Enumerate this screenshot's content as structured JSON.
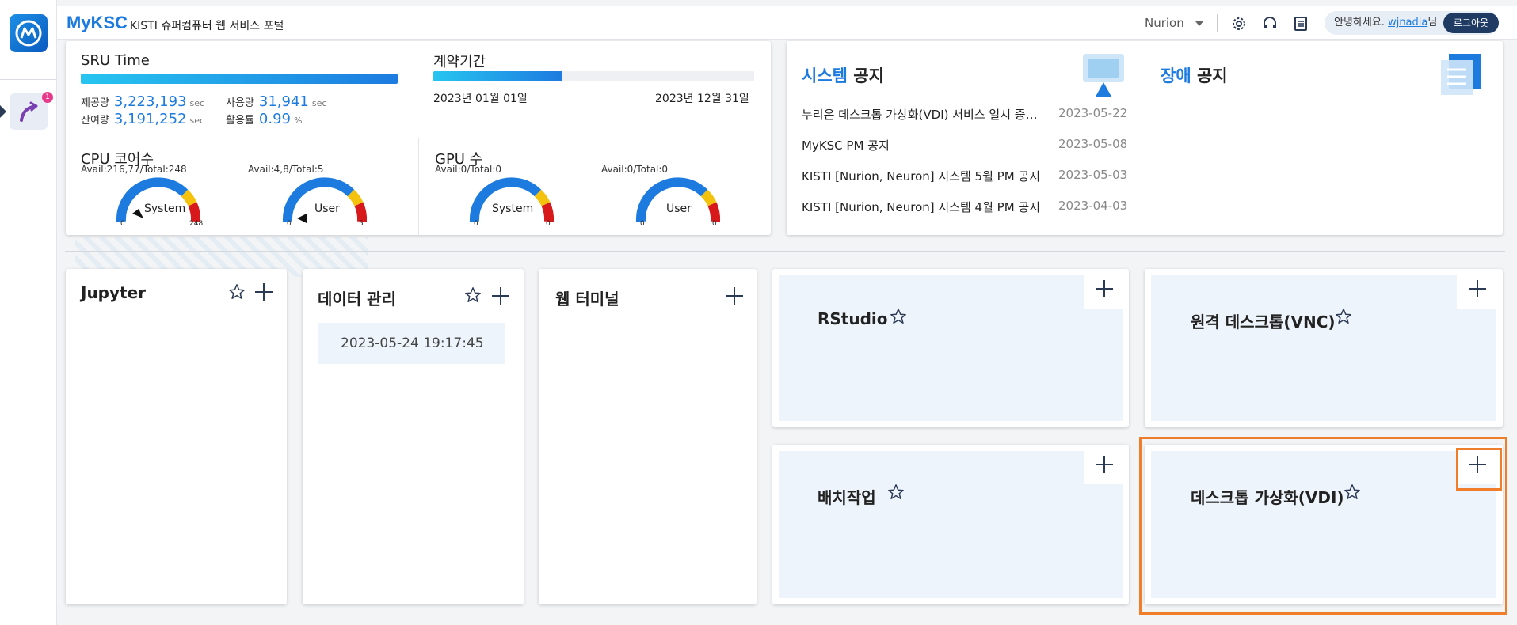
{
  "topbar": {
    "brand": "MyKSC",
    "brand_sub": "KISTI 슈퍼컴퓨터 웹 서비스 포털",
    "system_select": "Nurion",
    "greeting_prefix": "안녕하세요.",
    "username": "wjnadia",
    "greeting_suffix": "님",
    "logout_label": "로그아웃"
  },
  "sidebar": {
    "notification_count": "1"
  },
  "sru": {
    "title": "SRU Time",
    "progress": 1.0,
    "provided_label": "제공량",
    "provided_value": "3,223,193",
    "used_label": "사용량",
    "used_value": "31,941",
    "remaining_label": "잔여량",
    "remaining_value": "3,191,252",
    "utilization_label": "활용률",
    "utilization_value": "0.99",
    "unit_sec": "sec",
    "unit_pct": "%"
  },
  "contract": {
    "title": "계약기간",
    "progress": 0.4,
    "start": "2023년 01월 01일",
    "end": "2023년 12월 31일"
  },
  "cpu": {
    "title": "CPU 코어수",
    "system": {
      "avail": "Avail:216,77/Total:248",
      "label": "System",
      "min": "0",
      "max": "248"
    },
    "user": {
      "avail": "Avail:4,8/Total:5",
      "label": "User",
      "min": "0",
      "max": "5"
    }
  },
  "gpu": {
    "title": "GPU 수",
    "system": {
      "avail": "Avail:0/Total:0",
      "label": "System",
      "min": "0",
      "max": "0"
    },
    "user": {
      "avail": "Avail:0/Total:0",
      "label": "User",
      "min": "0",
      "max": "0"
    }
  },
  "system_notice": {
    "title_hl": "시스템",
    "title_rest": "공지",
    "items": [
      {
        "text": "누리온 데스크톱 가상화(VDI) 서비스 일시 중단 안내",
        "date": "2023-05-22"
      },
      {
        "text": "MyKSC PM 공지",
        "date": "2023-05-08"
      },
      {
        "text": "KISTI [Nurion, Neuron] 시스템 5월 PM 공지",
        "date": "2023-05-03"
      },
      {
        "text": "KISTI [Nurion, Neuron] 시스템 4월 PM 공지",
        "date": "2023-04-03"
      }
    ]
  },
  "fault_notice": {
    "title_hl": "장애",
    "title_rest": "공지"
  },
  "apps": {
    "jupyter": {
      "title": "Jupyter"
    },
    "data": {
      "title": "데이터 관리",
      "timestamp": "2023-05-24 19:17:45"
    },
    "terminal": {
      "title": "웹 터미널"
    },
    "rstudio": {
      "title": "RStudio"
    },
    "vnc": {
      "title": "원격 데스크톱(VNC)"
    },
    "batch": {
      "title": "배치작업"
    },
    "vdi": {
      "title": "데스크톱 가상화(VDI)"
    }
  },
  "colors": {
    "accent": "#1d7be0",
    "highlight": "#f07d2a"
  }
}
